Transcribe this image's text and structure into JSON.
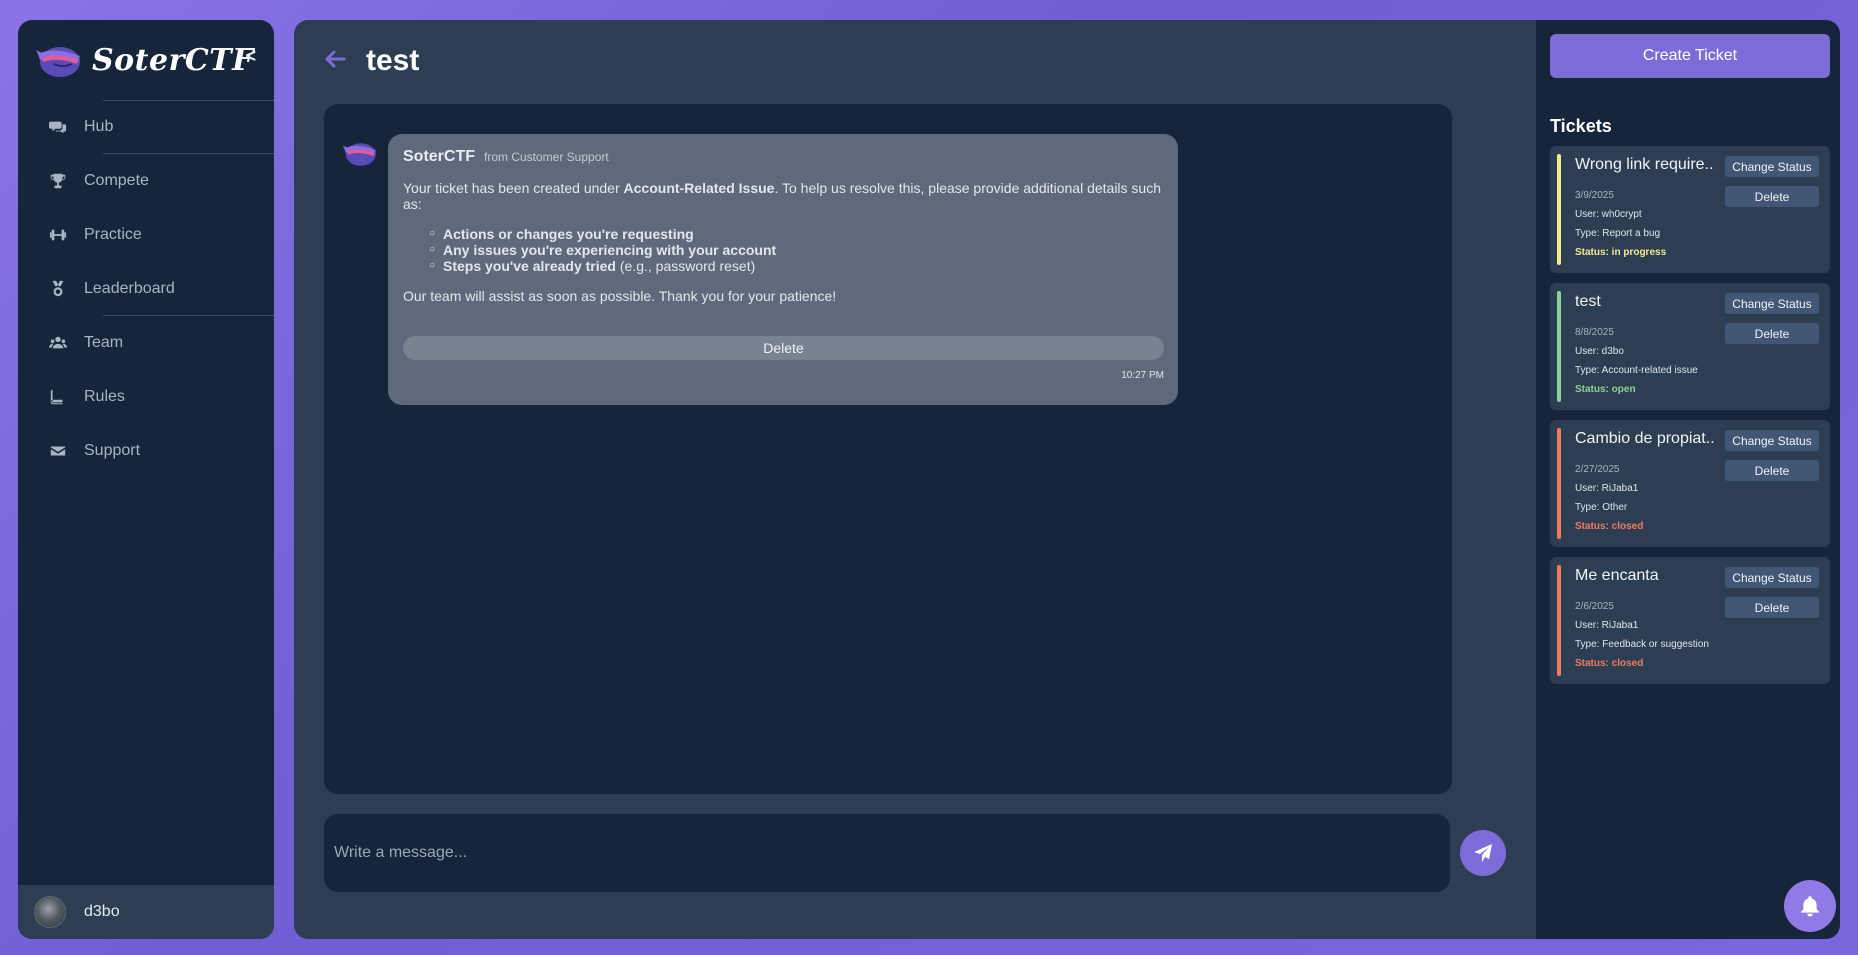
{
  "sidebar": {
    "brand": "SoterCTF",
    "collapse_label": "<",
    "items": [
      {
        "label": "Hub",
        "icon": "comments-icon"
      },
      {
        "label": "Compete",
        "icon": "trophy-icon"
      },
      {
        "label": "Practice",
        "icon": "dumbbell-icon"
      },
      {
        "label": "Leaderboard",
        "icon": "medal-icon"
      },
      {
        "label": "Team",
        "icon": "users-icon"
      },
      {
        "label": "Rules",
        "icon": "book-icon"
      },
      {
        "label": "Support",
        "icon": "envelope-icon"
      }
    ],
    "user": {
      "name": "d3bo"
    }
  },
  "header": {
    "title": "test"
  },
  "message": {
    "sender": "SoterCTF",
    "from": "from Customer Support",
    "intro_before": "Your ticket has been created under ",
    "intro_bold": "Account-Related Issue",
    "intro_after": ". To help us resolve this, please provide additional details such as:",
    "list": [
      {
        "bold": "Actions or changes you're requesting",
        "rest": ""
      },
      {
        "bold": "Any issues you're experiencing with your account",
        "rest": ""
      },
      {
        "bold": "Steps you've already tried",
        "rest": " (e.g., password reset)"
      }
    ],
    "closing": "Our team will assist as soon as possible. Thank you for your patience!",
    "delete_label": "Delete",
    "time": "10:27 PM"
  },
  "composer": {
    "placeholder": "Write a message..."
  },
  "right": {
    "create_label": "Create Ticket",
    "tickets_title": "Tickets",
    "change_status_label": "Change Status",
    "delete_label": "Delete",
    "tickets": [
      {
        "title": "Wrong link require...",
        "date": "3/9/2025",
        "user": "User: wh0crypt",
        "type": "Type: Report a bug",
        "status": "Status: in progress",
        "color": "#f2ea8f"
      },
      {
        "title": "test",
        "date": "8/8/2025",
        "user": "User: d3bo",
        "type": "Type: Account-related issue",
        "status": "Status: open",
        "color": "#8fd19e"
      },
      {
        "title": "Cambio de propiat...",
        "date": "2/27/2025",
        "user": "User: RiJaba1",
        "type": "Type: Other",
        "status": "Status: closed",
        "color": "#f07a63"
      },
      {
        "title": "Me encanta",
        "date": "2/6/2025",
        "user": "User: RiJaba1",
        "type": "Type: Feedback or suggestion",
        "status": "Status: closed",
        "color": "#f07a63"
      }
    ]
  },
  "colors": {
    "accent": "#7f6bd8",
    "panel": "#16253a",
    "surface": "#2e3e52"
  }
}
